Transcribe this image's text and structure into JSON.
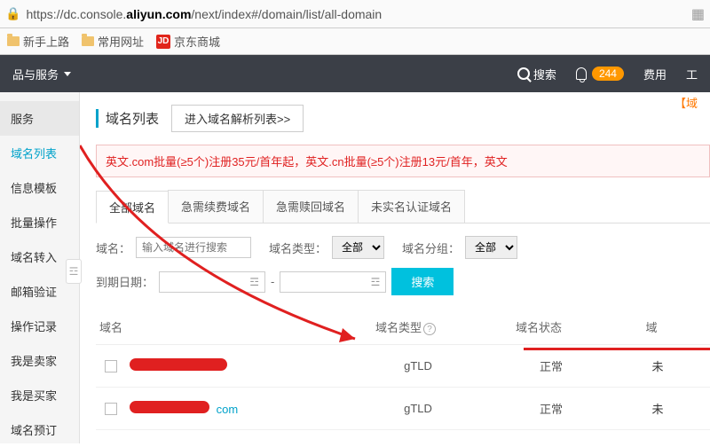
{
  "address_bar": {
    "url_prefix": "https://dc.console.",
    "url_bold": "aliyun.com",
    "url_suffix": "/next/index#/domain/list/all-domain"
  },
  "bookmarks": {
    "item1": "新手上路",
    "item2": "常用网址",
    "jd_badge": "JD",
    "item3": "京东商城"
  },
  "topnav": {
    "products": "品与服务",
    "search": "搜索",
    "notif_count": "244",
    "fees": "费用",
    "last": "工"
  },
  "sidebar": {
    "items": [
      "服务",
      "域名列表",
      "信息模板",
      "批量操作",
      "域名转入",
      "邮箱验证",
      "操作记录",
      "我是卖家",
      "我是买家",
      "域名预订"
    ],
    "collapse": "☲"
  },
  "page": {
    "title": "域名列表",
    "goto_parse": "进入域名解析列表>>",
    "orange_right": "【域",
    "promo": "英文.com批量(≥5个)注册35元/首年起，英文.cn批量(≥5个)注册13元/首年，英文"
  },
  "inner_tabs": {
    "t1": "全部域名",
    "t2": "急需续费域名",
    "t3": "急需赎回域名",
    "t4": "未实名认证域名"
  },
  "filters": {
    "domain_label": "域名：",
    "domain_placeholder": "输入域名进行搜索",
    "type_label": "域名类型：",
    "type_value": "全部",
    "group_label": "域名分组：",
    "group_value": "全部",
    "expire_label": "到期日期：",
    "date_icon": "☲",
    "dash": "-",
    "search_btn": "搜索"
  },
  "table": {
    "headers": {
      "domain": "域名",
      "type": "域名类型",
      "status": "域名状态",
      "last": "域"
    },
    "rows": [
      {
        "suffix": "",
        "type": "gTLD",
        "status": "正常",
        "last": "未"
      },
      {
        "suffix": "com",
        "type": "gTLD",
        "status": "正常",
        "last": "未"
      }
    ]
  }
}
